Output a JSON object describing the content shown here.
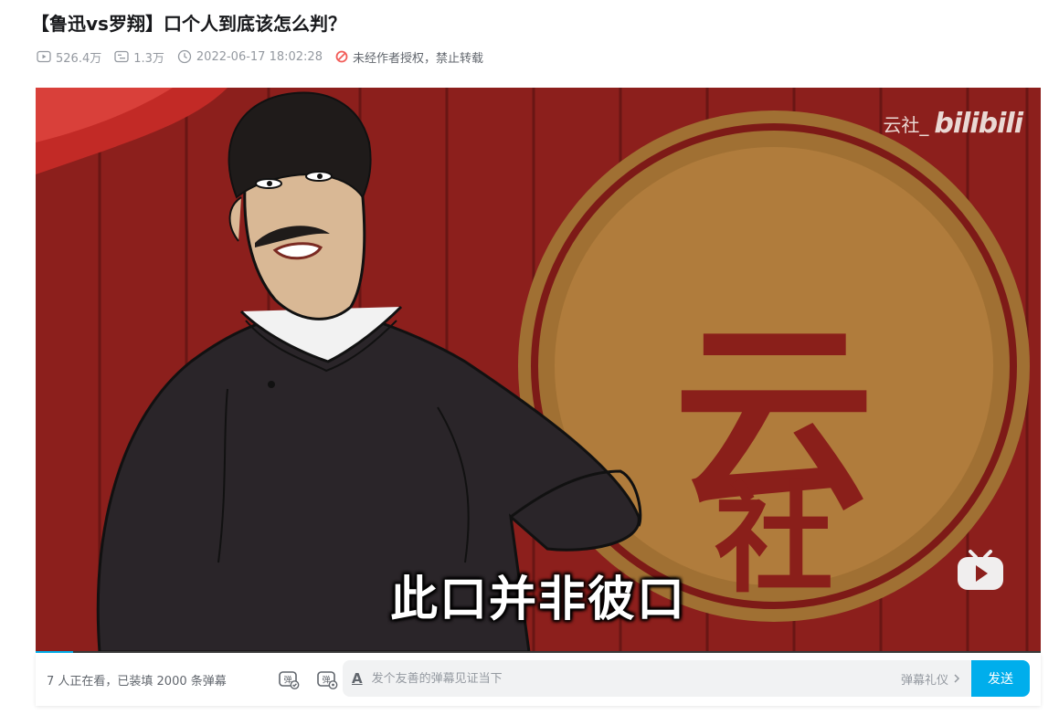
{
  "video": {
    "title": "【鲁迅vs罗翔】口个人到底该怎么判？",
    "views": "526.4万",
    "danmaku_count": "1.3万",
    "publish_time": "2022-06-17 18:02:28",
    "copyright_notice": "未经作者授权，禁止转载"
  },
  "player": {
    "watermark_name": "云社_",
    "watermark_logo": "bilibili",
    "subtitle": "此口并非彼口",
    "background_text": "云社",
    "progress": 0.037,
    "colors": {
      "curtain": "#8c1f1c",
      "emblem": "#b07c3c",
      "accent": "#00aeec"
    }
  },
  "danmaku_bar": {
    "viewers": "7 人正在看，已装填 2000 条弹幕",
    "input_placeholder": "发个友善的弹幕见证当下",
    "etiquette_label": "弹幕礼仪",
    "send_label": "发送"
  },
  "icons": {
    "views": "play-count-icon",
    "danmaku": "danmaku-count-icon",
    "time": "clock-icon",
    "no_repost": "forbidden-icon",
    "dm_toggle": "danmaku-toggle-icon",
    "dm_settings": "danmaku-settings-icon",
    "font": "danmaku-style-icon",
    "chevron": "chevron-right-icon",
    "tv": "bilibili-tv-icon"
  }
}
